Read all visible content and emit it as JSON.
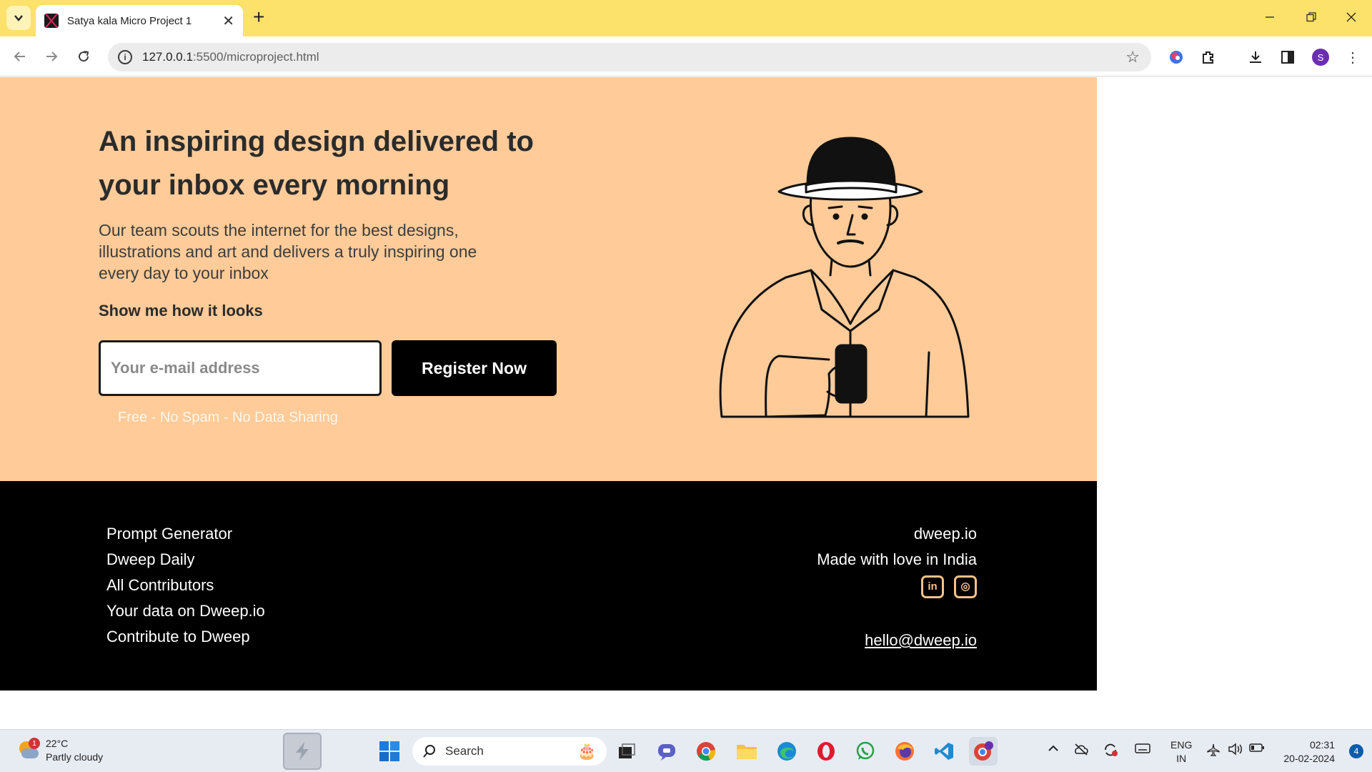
{
  "browser": {
    "tab_title": "Satya kala Micro Project 1",
    "tab_close": "✕",
    "new_tab": "+",
    "url_host": "127.0.0.1",
    "url_path": ":5500/microproject.html",
    "profile_initial": "S"
  },
  "hero": {
    "headline": "An inspiring design delivered to your inbox every morning",
    "lead": "Our team scouts the internet for the best designs, illustrations and art and delivers a truly inspiring one every day to your inbox",
    "show_label": "Show me how it looks",
    "email_placeholder": "Your e-mail address",
    "register_label": "Register Now",
    "note": "Free - No Spam - No Data Sharing"
  },
  "footer": {
    "links": [
      "Prompt Generator",
      "Dweep Daily",
      "All Contributors",
      "Your data on Dweep.io",
      "Contribute to Dweep"
    ],
    "brand": "dweep.io",
    "tagline": "Made with love in India",
    "email": "hello@dweep.io"
  },
  "taskbar": {
    "weather_badge": "1",
    "temperature": "22°C",
    "condition": "Partly cloudy",
    "search_label": "Search",
    "lang_line1": "ENG",
    "lang_line2": "IN",
    "time": "02:31",
    "date": "20-02-2024",
    "notification_count": "4"
  },
  "colors": {
    "hero_bg": "#fecb99",
    "tabstrip_bg": "#fce16b",
    "footer_bg": "#000000",
    "social_accent": "#f6c18b"
  }
}
